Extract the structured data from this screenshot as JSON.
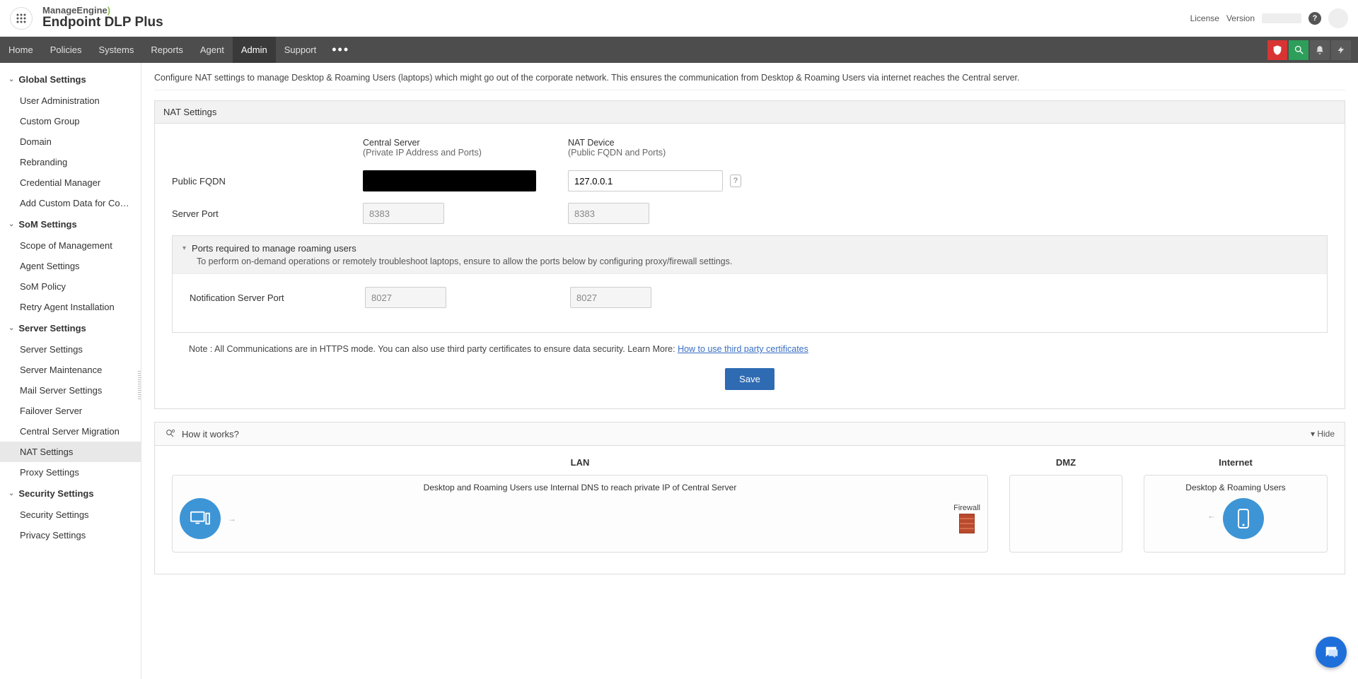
{
  "header": {
    "brand_top": "ManageEngine",
    "brand_bottom": "Endpoint DLP Plus",
    "license": "License",
    "version": "Version"
  },
  "nav": {
    "items": [
      "Home",
      "Policies",
      "Systems",
      "Reports",
      "Agent",
      "Admin",
      "Support"
    ],
    "active_index": 5
  },
  "sidebar": {
    "groups": [
      {
        "title": "Global Settings",
        "items": [
          "User Administration",
          "Custom Group",
          "Domain",
          "Rebranding",
          "Credential Manager",
          "Add Custom Data for Comput..."
        ]
      },
      {
        "title": "SoM Settings",
        "items": [
          "Scope of Management",
          "Agent Settings",
          "SoM Policy",
          "Retry Agent Installation"
        ]
      },
      {
        "title": "Server Settings",
        "items": [
          "Server Settings",
          "Server Maintenance",
          "Mail Server Settings",
          "Failover Server",
          "Central Server Migration",
          "NAT Settings",
          "Proxy Settings"
        ],
        "active_item": "NAT Settings"
      },
      {
        "title": "Security Settings",
        "items": [
          "Security Settings",
          "Privacy Settings"
        ]
      }
    ]
  },
  "main": {
    "intro": "Configure NAT settings to manage Desktop & Roaming Users (laptops) which might go out of the corporate network. This ensures the communication from Desktop & Roaming Users via internet reaches the Central server.",
    "panel_title": "NAT Settings",
    "columns": {
      "central_title": "Central Server",
      "central_sub": "(Private IP Address and Ports)",
      "nat_title": "NAT Device",
      "nat_sub": "(Public FQDN and Ports)"
    },
    "rows": {
      "public_fqdn_label": "Public FQDN",
      "public_fqdn_central_value": "",
      "public_fqdn_nat_value": "127.0.0.1",
      "server_port_label": "Server Port",
      "server_port_central_value": "8383",
      "server_port_nat_value": "8383"
    },
    "sub_panel": {
      "title": "Ports required to manage roaming users",
      "desc": "To perform on-demand operations or remotely troubleshoot laptops, ensure to allow the ports below by configuring proxy/firewall settings.",
      "notification_port_label": "Notification Server Port",
      "notification_port_central": "8027",
      "notification_port_nat": "8027"
    },
    "note_prefix": "Note : All Communications are in HTTPS mode. You can also use third party certificates to ensure data security. Learn More: ",
    "note_link": "How to use third party certificates",
    "save_label": "Save"
  },
  "how": {
    "title": "How it works?",
    "hide": "Hide",
    "lan_title": "LAN",
    "dmz_title": "DMZ",
    "internet_title": "Internet",
    "lan_text": "Desktop and Roaming Users use Internal DNS to reach private IP of Central Server",
    "internet_text": "Desktop & Roaming Users",
    "firewall_label": "Firewall"
  }
}
